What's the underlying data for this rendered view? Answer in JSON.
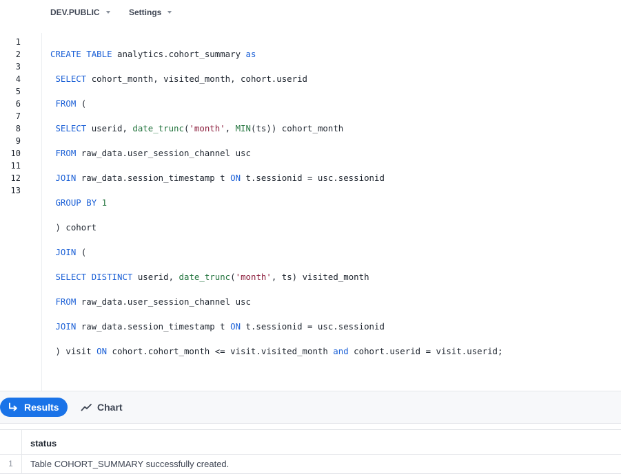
{
  "context": {
    "database": "DEV.PUBLIC",
    "settings": "Settings"
  },
  "editor": {
    "line_numbers": [
      "1",
      "2",
      "3",
      "4",
      "5",
      "6",
      "7",
      "8",
      "9",
      "10",
      "11",
      "12",
      "13"
    ]
  },
  "results_bar": {
    "results_label": "Results",
    "chart_label": "Chart",
    "accent_color": "#1a73e8"
  },
  "results_table": {
    "columns": [
      "status"
    ],
    "rows": [
      {
        "index": "1",
        "status": "Table COHORT_SUMMARY successfully created."
      }
    ]
  }
}
